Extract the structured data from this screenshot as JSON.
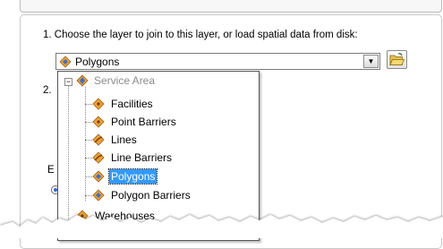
{
  "steps": {
    "step1_label": "1.  Choose the layer to join to this layer, or load spatial data from disk:",
    "step2_number": "2.",
    "side_fragment": "E"
  },
  "layer_combo": {
    "selected_value": "Polygons",
    "selected_icon": "polygon-layer-icon",
    "dropdown_arrow": "▼",
    "browse_icon": "open-folder-icon"
  },
  "layer_tree": {
    "root": {
      "label": "Service Area",
      "expander": "−",
      "icon": "network-analysis-layer-icon"
    },
    "items": [
      {
        "label": "Facilities",
        "icon": "point-layer-icon"
      },
      {
        "label": "Point Barriers",
        "icon": "point-layer-icon"
      },
      {
        "label": "Lines",
        "icon": "line-layer-icon"
      },
      {
        "label": "Line Barriers",
        "icon": "line-layer-icon"
      },
      {
        "label": "Polygons",
        "icon": "polygon-layer-icon",
        "selected": true
      },
      {
        "label": "Polygon Barriers",
        "icon": "polygon-layer-icon"
      }
    ],
    "next_root": {
      "label": "Warehouses",
      "icon": "point-layer-icon"
    }
  },
  "colors": {
    "selection": "#3399ff",
    "disabled_text": "#8c8c8c",
    "layer_icon_orange": "#f0a030",
    "layer_icon_blue": "#3a6fd0"
  }
}
